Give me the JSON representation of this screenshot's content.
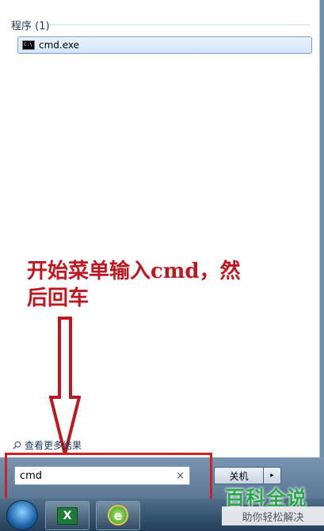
{
  "results": {
    "section_title": "程序 (1)",
    "items": [
      {
        "label": "cmd.exe",
        "icon": "cmd-icon"
      }
    ]
  },
  "annotation": {
    "line1": "开始菜单输入cmd，然",
    "line2": "后回车",
    "color": "#c0161f"
  },
  "see_more": {
    "label": "查看更多结果"
  },
  "search": {
    "value": "cmd",
    "clear_symbol": "×"
  },
  "power": {
    "shutdown_label": "关机",
    "arrow_symbol": "▸"
  },
  "taskbar": {
    "apps": [
      {
        "name": "excel",
        "glyph": "X"
      },
      {
        "name": "browser",
        "glyph": "e"
      }
    ]
  },
  "watermark": {
    "main": "百科全说",
    "sub": "助你轻松解决"
  }
}
